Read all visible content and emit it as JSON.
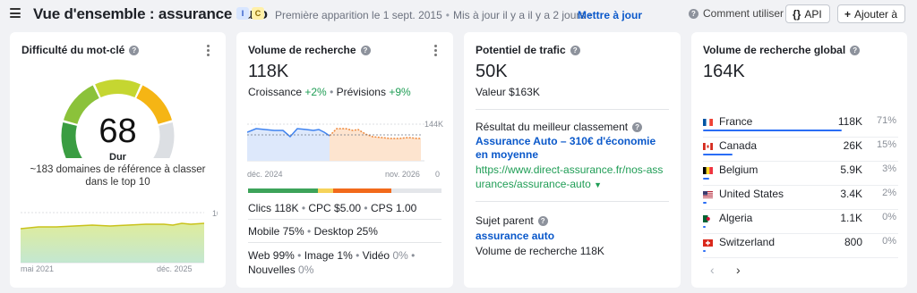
{
  "header": {
    "title": "Vue d'ensemble : assurance auto",
    "intent_i": "I",
    "intent_c": "C",
    "first_seen": "Première apparition le 1 sept. 2015",
    "updated": "Mis à jour il y a il y a 2 jours",
    "update_link": "Mettre à jour",
    "help": "Comment utiliser",
    "api_label": "API",
    "add_label": "Ajouter à"
  },
  "kd": {
    "title": "Difficulté du mot-clé",
    "value": "68",
    "level": "Dur",
    "description": "~183 domaines de référence à classer dans le top 10",
    "chart_max": "100",
    "chart_min": "0",
    "x_start": "mai 2021",
    "x_end": "déc. 2025",
    "gauge_score": 68
  },
  "volume": {
    "title": "Volume de recherche",
    "value": "118K",
    "growth_label": "Croissance",
    "growth_value": "+2%",
    "forecast_label": "Prévisions",
    "forecast_value": "+9%",
    "chart_max": "144K",
    "chart_min": "0",
    "x_start": "déc. 2024",
    "x_end": "nov. 2026",
    "clicks": "Clics 118K",
    "cpc": "CPC $5.00",
    "cps": "CPS 1.00",
    "mobile": "Mobile 75%",
    "desktop": "Desktop 25%",
    "web": "Web 99%",
    "image": "Image 1%",
    "video_label": "Vidéo",
    "video_value": "0%",
    "news_label": "Nouvelles",
    "news_value": "0%",
    "split": [
      {
        "share": 0.36,
        "color": "#3da35a"
      },
      {
        "share": 0.08,
        "color": "#f6d35a"
      },
      {
        "share": 0.3,
        "color": "#f26a1b"
      },
      {
        "share": 0.26,
        "color": "#e4e6ea"
      }
    ]
  },
  "traffic": {
    "title": "Potentiel de trafic",
    "value": "50K",
    "value_sub": "Valeur $163K",
    "best_label": "Résultat du meilleur classement",
    "best_title": "Assurance Auto – 310€ d'économie en moyenne",
    "best_url": "https://www.direct-assurance.fr/nos-assurances/assurance-auto",
    "parent_label": "Sujet parent",
    "parent_topic": "assurance auto",
    "parent_volume": "Volume de recherche 118K"
  },
  "global": {
    "title": "Volume de recherche global",
    "value": "164K",
    "countries": [
      {
        "name": "France",
        "volume": "118K",
        "pct": "71%",
        "share": 0.71,
        "flag": "fr"
      },
      {
        "name": "Canada",
        "volume": "26K",
        "pct": "15%",
        "share": 0.15,
        "flag": "ca"
      },
      {
        "name": "Belgium",
        "volume": "5.9K",
        "pct": "3%",
        "share": 0.03,
        "flag": "be"
      },
      {
        "name": "United States",
        "volume": "3.4K",
        "pct": "2%",
        "share": 0.02,
        "flag": "us"
      },
      {
        "name": "Algeria",
        "volume": "1.1K",
        "pct": "0%",
        "share": 0.005,
        "flag": "dz"
      },
      {
        "name": "Switzerland",
        "volume": "800",
        "pct": "0%",
        "share": 0.004,
        "flag": "ch"
      }
    ],
    "prev": "‹",
    "next": "›"
  },
  "colors": {
    "accent": "#0a58ca",
    "positive": "#1f9d55",
    "bar": "#2a6df5"
  }
}
